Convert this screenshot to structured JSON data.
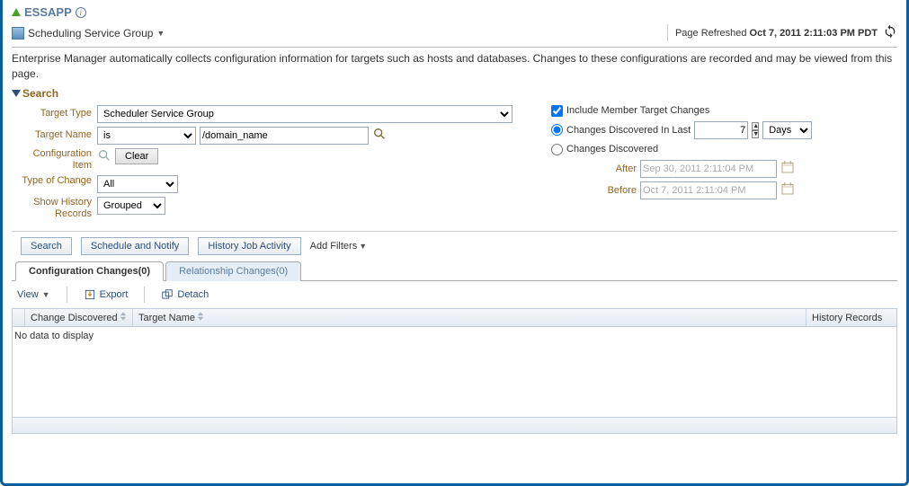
{
  "header": {
    "app_title": "ESSAPP",
    "breadcrumb": "Scheduling Service Group",
    "refresh_prefix": "Page Refreshed",
    "refresh_time": "Oct 7, 2011 2:11:03 PM PDT"
  },
  "description": "Enterprise Manager automatically collects configuration information for targets such as hosts and databases. Changes to these configurations are recorded and may be viewed from this page.",
  "search": {
    "title": "Search",
    "labels": {
      "target_type": "Target Type",
      "target_name": "Target Name",
      "config_item": "Configuration Item",
      "type_of_change": "Type of Change",
      "show_history": "Show History Records"
    },
    "target_type_value": "Scheduler Service Group",
    "target_name_op": "is",
    "target_name_value": "/domain_name",
    "clear_btn": "Clear",
    "type_of_change_value": "All",
    "show_history_value": "Grouped",
    "include_member": "Include Member Target Changes",
    "discovered_last": "Changes Discovered In Last",
    "discovered_last_value": "7",
    "discovered_last_unit": "Days",
    "discovered": "Changes Discovered",
    "after_label": "After",
    "after_value": "Sep 30, 2011 2:11:04 PM",
    "before_label": "Before",
    "before_value": "Oct 7, 2011 2:11:04 PM"
  },
  "actions": {
    "search": "Search",
    "schedule": "Schedule and Notify",
    "history": "History Job Activity",
    "add_filters": "Add Filters"
  },
  "tabs": {
    "config": "Configuration Changes(0)",
    "relation": "Relationship Changes(0)"
  },
  "toolbar": {
    "view": "View",
    "export": "Export",
    "detach": "Detach"
  },
  "table": {
    "cols": {
      "c1": "Change Discovered",
      "c2": "Target Name",
      "c3": "History Records"
    },
    "empty": "No data to display"
  }
}
